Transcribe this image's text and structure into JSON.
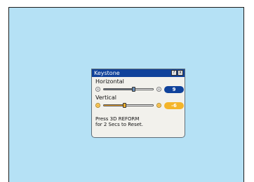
{
  "dialog": {
    "title": "Keystone",
    "help_icon": "?",
    "close_icon": "x"
  },
  "horizontal": {
    "label": "Horizontal",
    "value": "9",
    "level": 0.62
  },
  "vertical": {
    "label": "Vertical",
    "value": "-6",
    "level": 0.41
  },
  "message": {
    "line1": "Press 3D REFORM",
    "line2": "for 2 Secs to Reset."
  },
  "colors": {
    "title_bar": "#10429b",
    "active_accent": "#f4b52a",
    "screen": "#b5e1f5"
  }
}
